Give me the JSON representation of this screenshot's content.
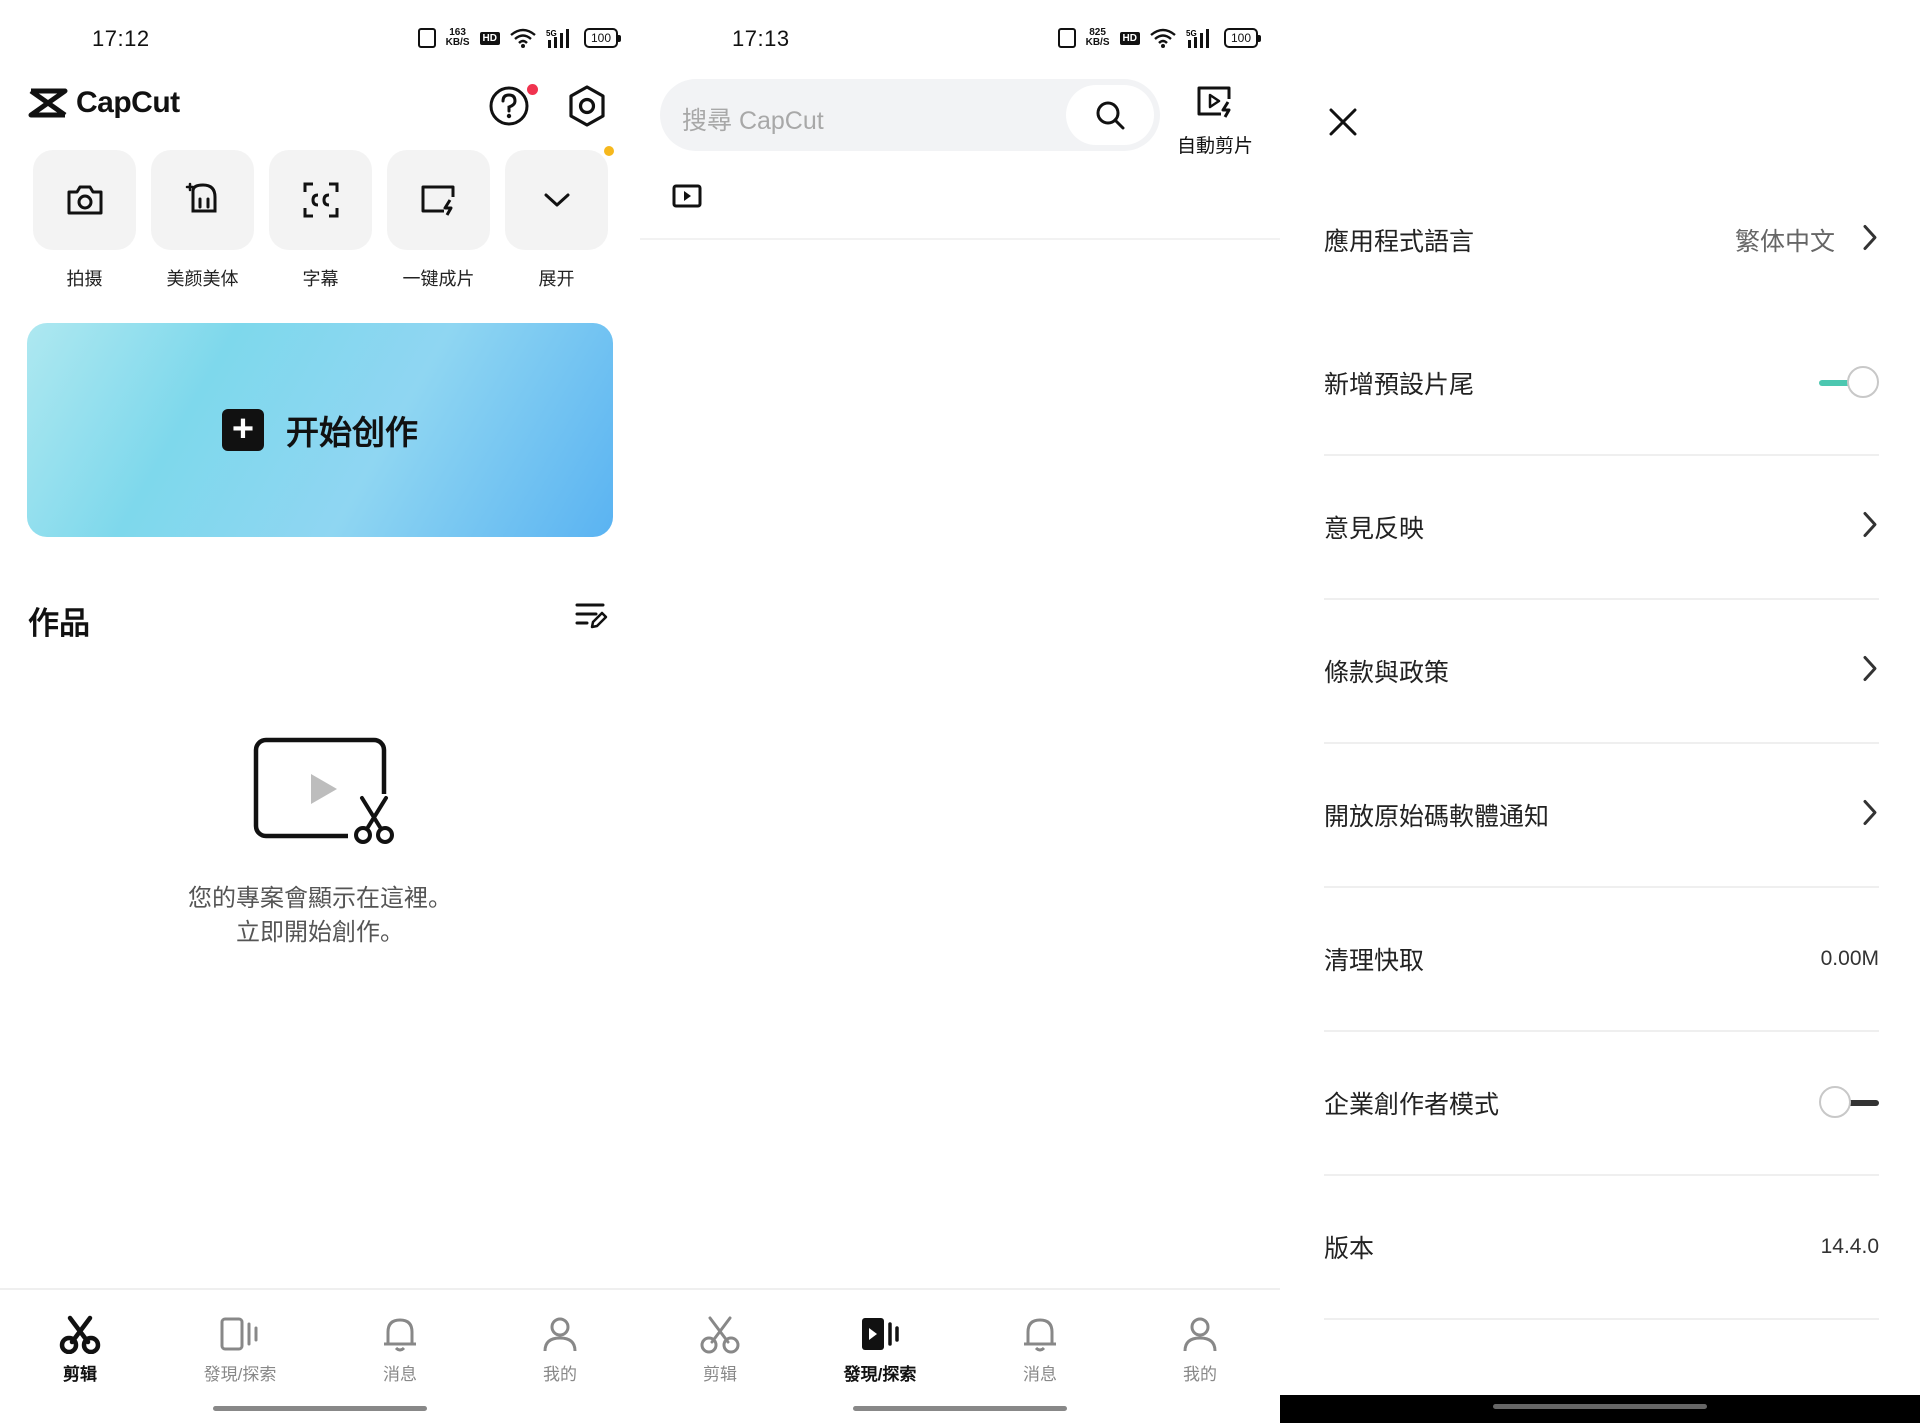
{
  "panel1": {
    "status": {
      "time": "17:12",
      "speed_top": "163",
      "speed_unit": "KB/S",
      "hd": "HD",
      "net": "5G",
      "battery": "100"
    },
    "brand": {
      "name": "CapCut"
    },
    "quick_actions": [
      {
        "label": "拍摄",
        "icon": "camera-icon"
      },
      {
        "label": "美颜美体",
        "icon": "face-retouch-icon"
      },
      {
        "label": "字幕",
        "icon": "captions-icon"
      },
      {
        "label": "一键成片",
        "icon": "auto-cut-icon"
      },
      {
        "label": "展开",
        "icon": "chevron-down-icon"
      }
    ],
    "create": {
      "plus": "+",
      "label": "开始创作"
    },
    "works": {
      "title": "作品"
    },
    "empty": {
      "line1": "您的專案會顯示在這裡。",
      "line2": "立即開始創作。"
    },
    "nav": [
      {
        "label": "剪辑",
        "active": true
      },
      {
        "label": "發現/探索",
        "active": false
      },
      {
        "label": "消息",
        "active": false
      },
      {
        "label": "我的",
        "active": false
      }
    ]
  },
  "panel2": {
    "status": {
      "time": "17:13",
      "speed_top": "825",
      "speed_unit": "KB/S",
      "hd": "HD",
      "net": "5G",
      "battery": "100"
    },
    "search": {
      "placeholder": "搜尋 CapCut"
    },
    "autocut": {
      "label": "自動剪片"
    },
    "nav": [
      {
        "label": "剪辑",
        "active": false
      },
      {
        "label": "發現/探索",
        "active": true
      },
      {
        "label": "消息",
        "active": false
      },
      {
        "label": "我的",
        "active": false
      }
    ]
  },
  "panel3": {
    "settings": [
      {
        "title": "應用程式語言",
        "value": "繁体中文",
        "kind": "link"
      },
      {
        "title": "新增預設片尾",
        "kind": "toggle",
        "on": true
      },
      {
        "title": "意見反映",
        "kind": "link"
      },
      {
        "title": "條款與政策",
        "kind": "link"
      },
      {
        "title": "開放原始碼軟體通知",
        "kind": "link"
      },
      {
        "title": "清理快取",
        "value": "0.00M",
        "kind": "value"
      },
      {
        "title": "企業創作者模式",
        "kind": "toggle",
        "on": false
      },
      {
        "title": "版本",
        "value": "14.4.0",
        "kind": "value"
      }
    ]
  }
}
